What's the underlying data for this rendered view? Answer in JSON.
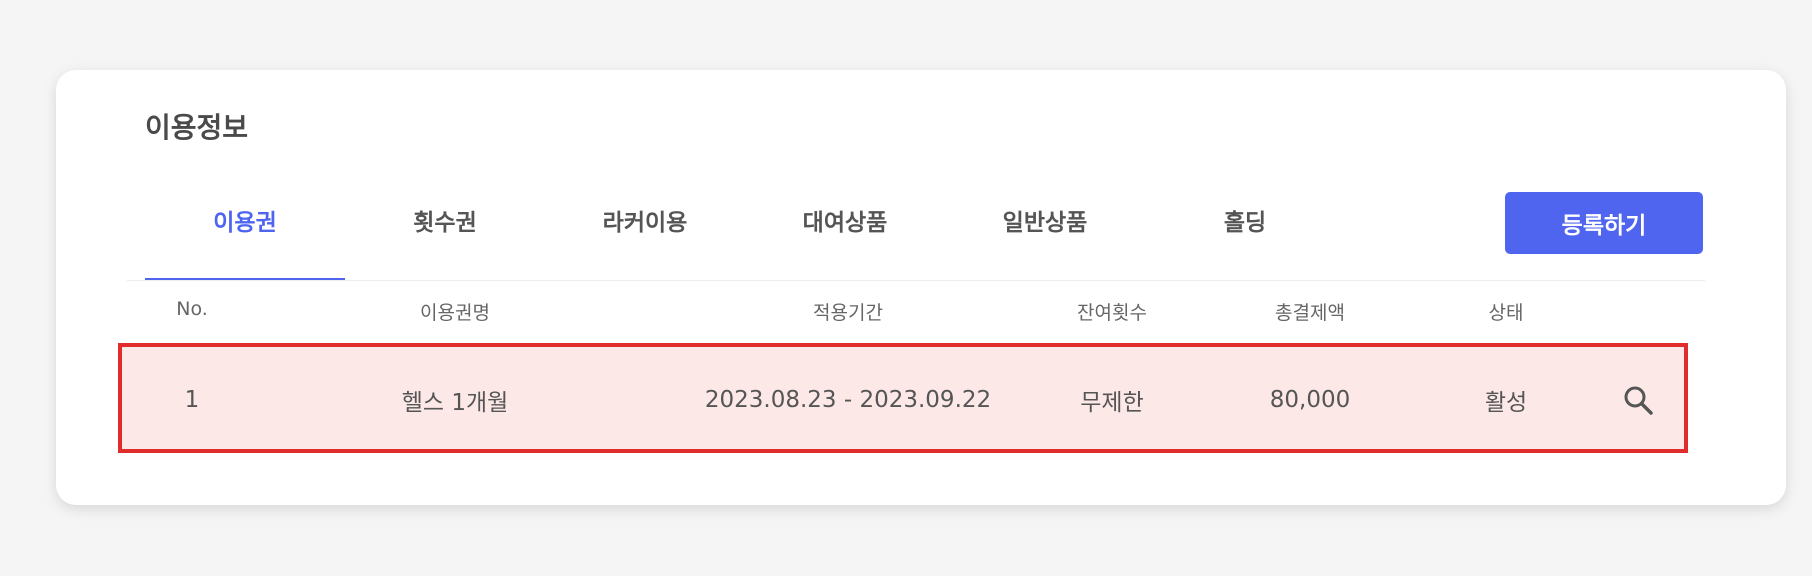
{
  "section": {
    "title": "이용정보"
  },
  "tabs": [
    {
      "label": "이용권",
      "active": true
    },
    {
      "label": "횟수권",
      "active": false
    },
    {
      "label": "라커이용",
      "active": false
    },
    {
      "label": "대여상품",
      "active": false
    },
    {
      "label": "일반상품",
      "active": false
    },
    {
      "label": "홀딩",
      "active": false
    }
  ],
  "register_button": {
    "label": "등록하기"
  },
  "table": {
    "headers": [
      "No.",
      "이용권명",
      "적용기간",
      "잔여횟수",
      "총결제액",
      "상태"
    ],
    "rows": [
      {
        "no": "1",
        "name": "헬스 1개월",
        "period": "2023.08.23 - 2023.09.22",
        "remaining": "무제한",
        "total": "80,000",
        "status": "활성",
        "action_icon": "search-icon"
      }
    ]
  },
  "colors": {
    "accent": "#4f65f0",
    "highlight_border": "#e02c2c",
    "highlight_fill": "#fde8e8"
  }
}
